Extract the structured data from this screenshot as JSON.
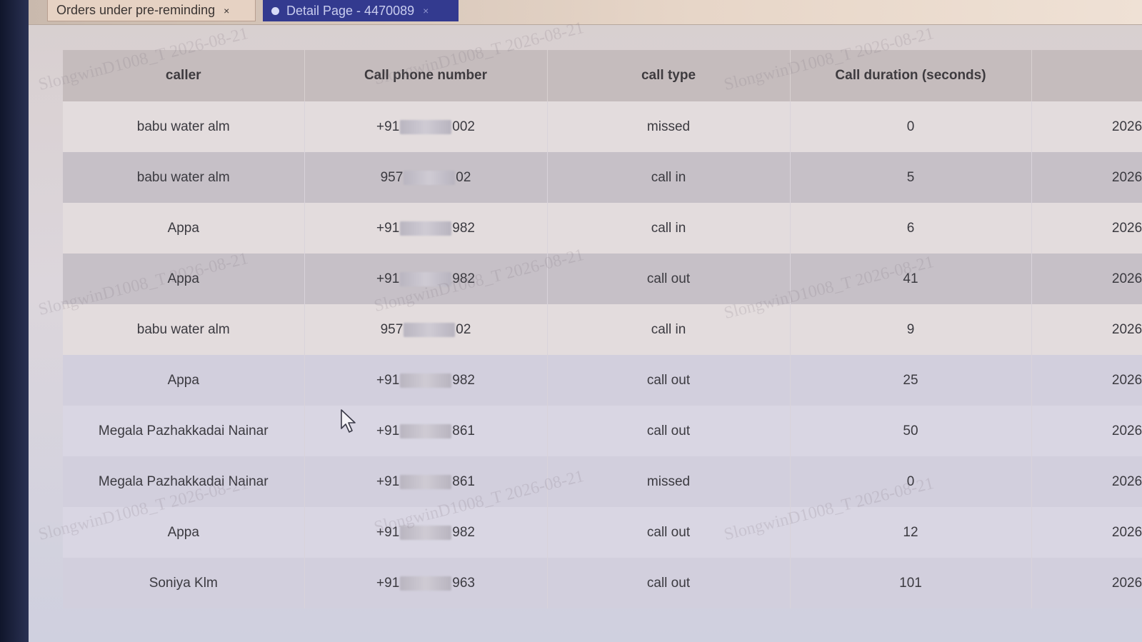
{
  "tabs": [
    {
      "label": "Orders under pre-reminding",
      "close": "×",
      "active": false
    },
    {
      "label": "Detail Page - 4470089",
      "close": "×",
      "active": true
    }
  ],
  "table": {
    "headers": [
      "caller",
      "Call phone number",
      "call type",
      "Call duration (seconds)",
      ""
    ],
    "rows": [
      {
        "caller": "babu water alm",
        "phone_prefix": "+91",
        "phone_suffix": "002",
        "type": "missed",
        "duration": "0",
        "date": "2026-"
      },
      {
        "caller": "babu water alm",
        "phone_prefix": "957",
        "phone_suffix": "02",
        "type": "call in",
        "duration": "5",
        "date": "2026-"
      },
      {
        "caller": "Appa",
        "phone_prefix": "+91",
        "phone_suffix": "982",
        "type": "call in",
        "duration": "6",
        "date": "2026-"
      },
      {
        "caller": "Appa",
        "phone_prefix": "+91",
        "phone_suffix": "982",
        "type": "call out",
        "duration": "41",
        "date": "2026-"
      },
      {
        "caller": "babu water alm",
        "phone_prefix": "957",
        "phone_suffix": "02",
        "type": "call in",
        "duration": "9",
        "date": "2026-"
      },
      {
        "caller": "Appa",
        "phone_prefix": "+91",
        "phone_suffix": "982",
        "type": "call out",
        "duration": "25",
        "date": "2026-"
      },
      {
        "caller": "Megala Pazhakkadai Nainar",
        "phone_prefix": "+91",
        "phone_suffix": "861",
        "type": "call out",
        "duration": "50",
        "date": "2026-"
      },
      {
        "caller": "Megala Pazhakkadai Nainar",
        "phone_prefix": "+91",
        "phone_suffix": "861",
        "type": "missed",
        "duration": "0",
        "date": "2026-"
      },
      {
        "caller": "Appa",
        "phone_prefix": "+91",
        "phone_suffix": "982",
        "type": "call out",
        "duration": "12",
        "date": "2026-"
      },
      {
        "caller": "Soniya Klm",
        "phone_prefix": "+91",
        "phone_suffix": "963",
        "type": "call out",
        "duration": "101",
        "date": "2026-"
      }
    ]
  },
  "watermark": "SlongwinD1008_T 2026-08-21",
  "colors": {
    "active_tab": "#333a8f",
    "header_bg": "#c5bcbd"
  }
}
